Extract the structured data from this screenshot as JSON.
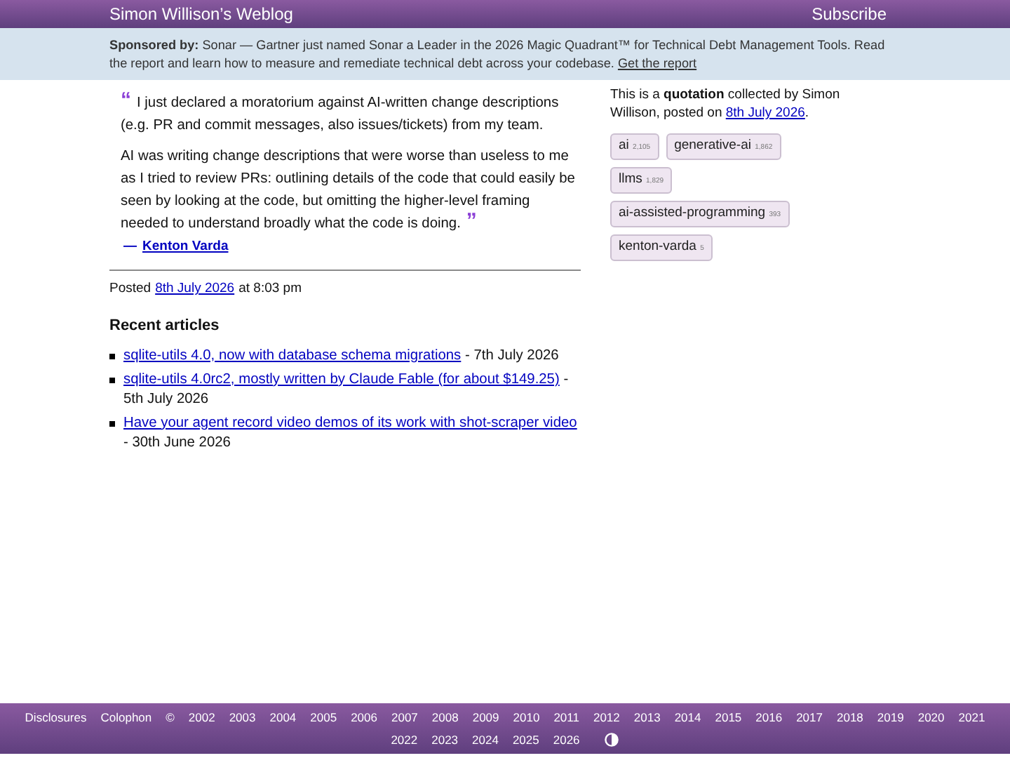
{
  "header": {
    "title": "Simon Willison’s Weblog",
    "subscribe": "Subscribe"
  },
  "sponsor": {
    "label": "Sponsored by:",
    "text": "Sonar — Gartner just named Sonar a Leader in the 2026 Magic Quadrant™ for Technical Debt Management Tools. Read the report and learn how to measure and remediate technical debt across your codebase.",
    "link": "Get the report"
  },
  "quote": {
    "open_mark": "“",
    "paragraphs": [
      "I just declared a moratorium against AI-written change descriptions (e.g. PR and commit messages, also issues/tickets) from my team.",
      "AI was writing change descriptions that were worse than useless to me as I tried to review PRs: outlining details of the code that could easily be seen by looking at the code, but omitting the higher-level framing needed to understand broadly what the code is doing."
    ],
    "close_mark": "”",
    "dash": "—",
    "author": "Kenton Varda"
  },
  "posted": {
    "prefix": "Posted",
    "date": "8th July 2026",
    "suffix": "at 8:03 pm"
  },
  "recent": {
    "heading": "Recent articles",
    "items": [
      {
        "title": "sqlite-utils 4.0, now with database schema migrations",
        "date": "- 7th July 2026"
      },
      {
        "title": "sqlite-utils 4.0rc2, mostly written by Claude Fable (for about $149.25)",
        "date": "- 5th July 2026"
      },
      {
        "title": "Have your agent record video demos of its work with shot-scraper video",
        "date": "- 30th June 2026"
      }
    ]
  },
  "sidebar": {
    "about": "This is a **quotation** collected by Simon Willison, posted on",
    "date": "8th July 2026",
    "end": ".",
    "tags": [
      {
        "name": "ai",
        "count": "2,105"
      },
      {
        "name": "generative-ai",
        "count": "1,862"
      },
      {
        "name": "llms",
        "count": "1,829"
      },
      {
        "name": "ai-assisted-programming",
        "count": "393"
      },
      {
        "name": "kenton-varda",
        "count": "5"
      }
    ]
  },
  "footer": {
    "links": [
      "Disclosures",
      "Colophon",
      "©"
    ],
    "years": [
      "2002",
      "2003",
      "2004",
      "2005",
      "2006",
      "2007",
      "2008",
      "2009",
      "2010",
      "2011",
      "2012",
      "2013",
      "2014",
      "2015",
      "2016",
      "2017",
      "2018",
      "2019",
      "2020",
      "2021",
      "2022",
      "2023",
      "2024",
      "2025",
      "2026"
    ]
  }
}
